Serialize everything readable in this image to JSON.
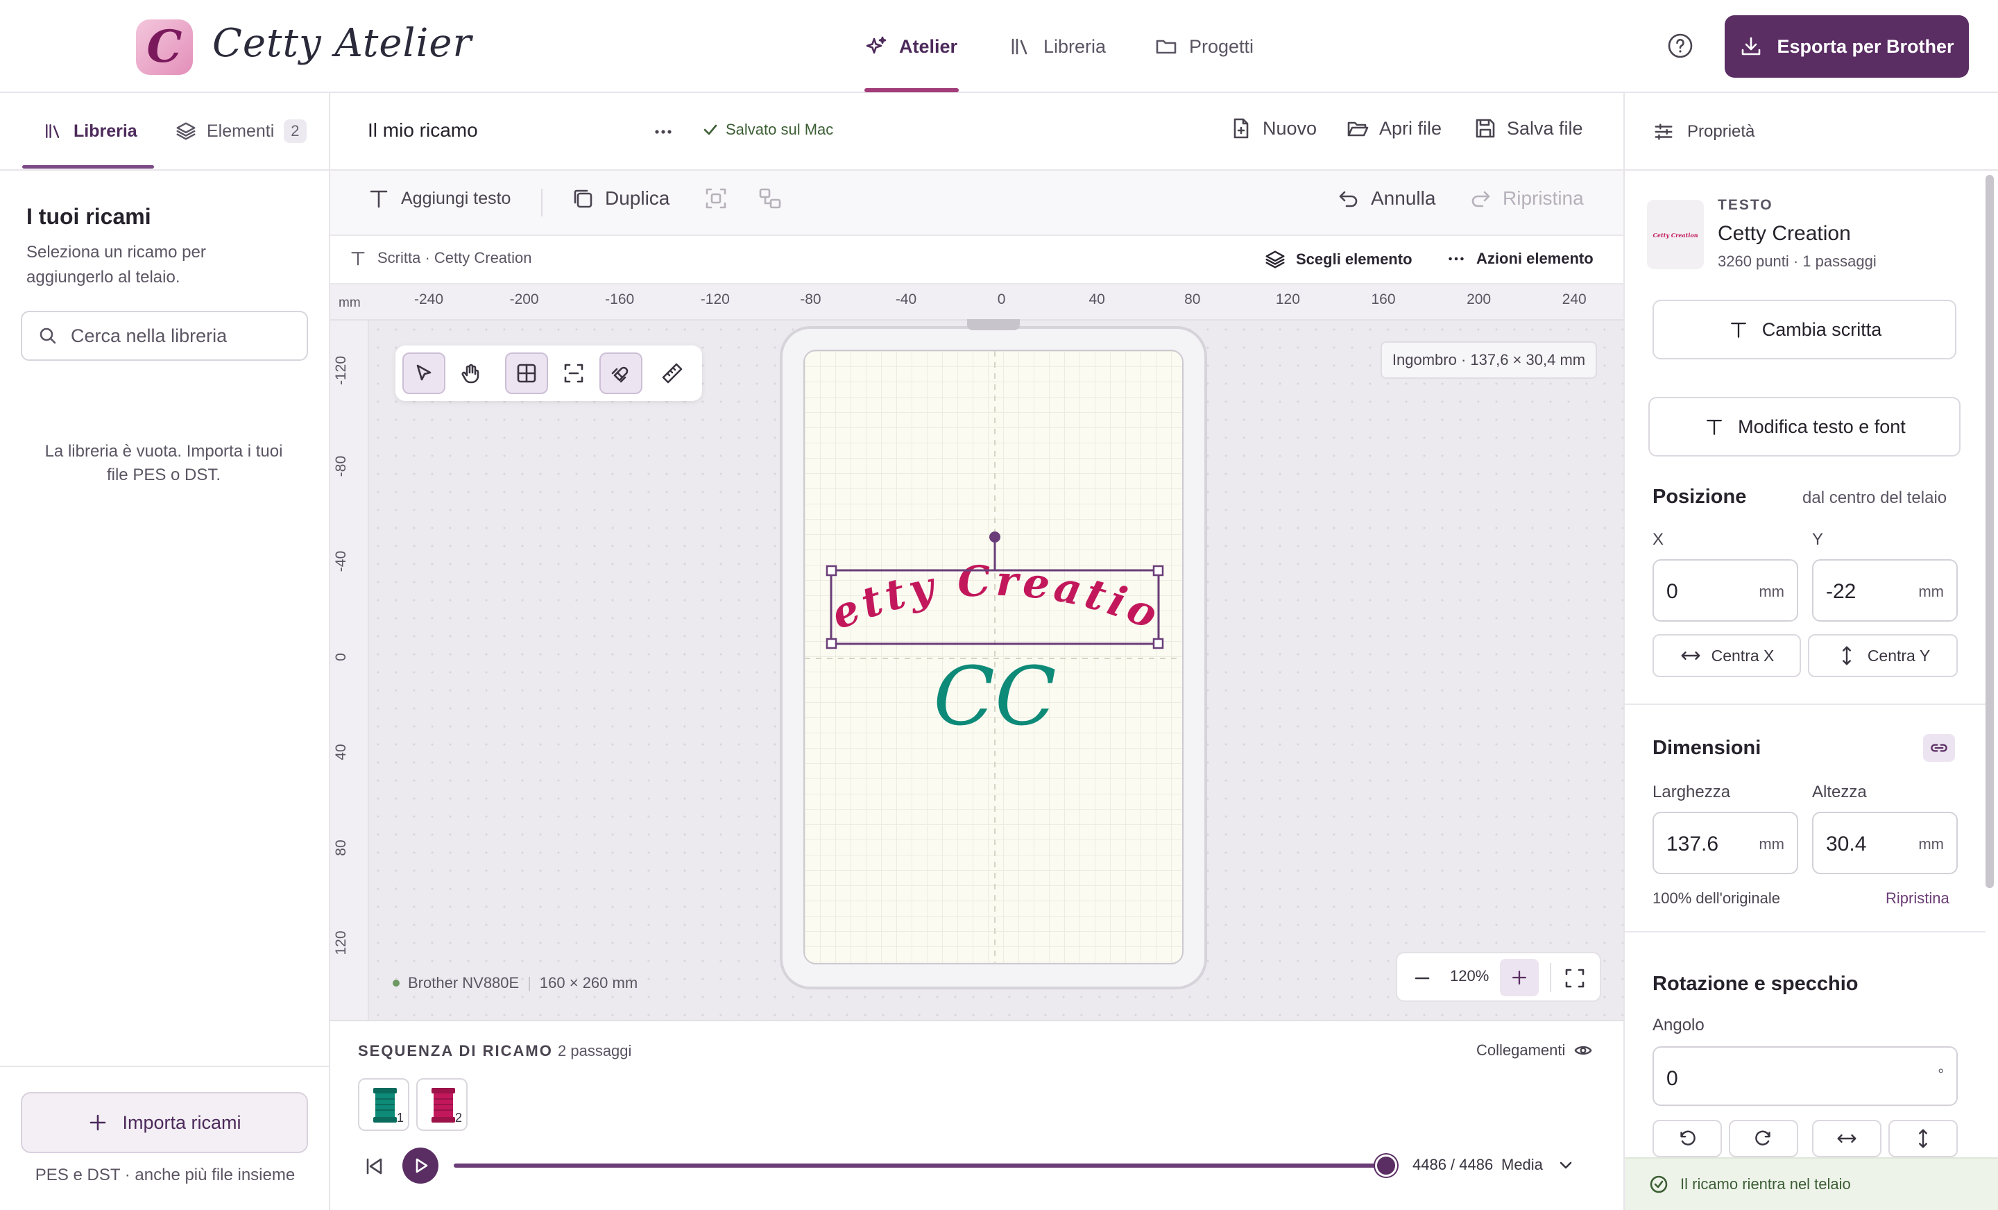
{
  "app": {
    "logo_letter": "C",
    "title": "Cetty Atelier"
  },
  "nav": {
    "tabs": [
      {
        "label": "Atelier",
        "icon": "sparkle-icon",
        "active": true
      },
      {
        "label": "Libreria",
        "icon": "books-icon",
        "active": false
      },
      {
        "label": "Progetti",
        "icon": "folder-icon",
        "active": false
      }
    ],
    "export_label": "Esporta per Brother"
  },
  "left": {
    "tabs": [
      {
        "label": "Libreria",
        "active": true
      },
      {
        "label": "Elementi",
        "badge": "2",
        "active": false
      }
    ],
    "title": "I tuoi ricami",
    "subtitle": "Seleziona un ricamo per aggiungerlo al telaio.",
    "search_placeholder": "Cerca nella libreria",
    "empty_text": "La libreria è vuota. Importa i tuoi file PES o DST.",
    "import_label": "Importa ricami",
    "import_hint": "PES e DST · anche più file insieme"
  },
  "document": {
    "title": "Il mio ricamo",
    "saved": "Salvato sul Mac",
    "actions": {
      "new": "Nuovo",
      "open": "Apri file",
      "save": "Salva file"
    }
  },
  "toolbar": {
    "add_text": "Aggiungi testo",
    "duplicate": "Duplica",
    "undo": "Annulla",
    "redo": "Ripristina"
  },
  "selection": {
    "label": "Scritta · Cetty Creation",
    "choose": "Scegli elemento",
    "actions": "Azioni elemento"
  },
  "ruler": {
    "unit": "mm",
    "h_ticks": [
      "-240",
      "-200",
      "-160",
      "-120",
      "-80",
      "-40",
      "0",
      "40",
      "80",
      "120",
      "160",
      "200",
      "240"
    ],
    "v_ticks": [
      "-120",
      "-80",
      "-40",
      "0",
      "40",
      "80",
      "120"
    ]
  },
  "canvas": {
    "bbox_info": "Ingombro · 137,6 × 30,4 mm",
    "machine": "Brother NV880E",
    "hoop_size": "160 × 260 mm",
    "zoom": "120%",
    "design_text_1": "Cetty Creation",
    "design_text_2": "CC",
    "colors": {
      "magenta": "#c2185b",
      "teal": "#0e8a78",
      "selection": "#6a3d78"
    }
  },
  "sequence": {
    "title": "SEQUENZA DI RICAMO",
    "count": "2 passaggi",
    "links": "Collegamenti",
    "spools": [
      {
        "num": "1",
        "color": "#0e8a78"
      },
      {
        "num": "2",
        "color": "#c2185b"
      }
    ],
    "progress_label": "4486 / 4486",
    "progress_fraction": 1.0,
    "speed": "Media"
  },
  "properties": {
    "title": "Proprietà",
    "element_type": "TESTO",
    "element_name": "Cetty Creation",
    "element_meta": "3260 punti · 1 passaggi",
    "thumb_text": "Cetty Creation",
    "change_text": "Cambia scritta",
    "edit_text_font": "Modifica testo e font",
    "position": {
      "title": "Posizione",
      "note": "dal centro del telaio",
      "x_label": "X",
      "x_value": "0",
      "y_label": "Y",
      "y_value": "-22",
      "unit": "mm",
      "center_x": "Centra X",
      "center_y": "Centra Y"
    },
    "dimensions": {
      "title": "Dimensioni",
      "w_label": "Larghezza",
      "w_value": "137.6",
      "h_label": "Altezza",
      "h_value": "30.4",
      "unit": "mm",
      "percent": "100% dell'originale",
      "reset": "Ripristina"
    },
    "rotation": {
      "title": "Rotazione e specchio",
      "angle_label": "Angolo",
      "angle_value": "0",
      "angle_unit": "°"
    },
    "status": "Il ricamo rientra nel telaio"
  }
}
